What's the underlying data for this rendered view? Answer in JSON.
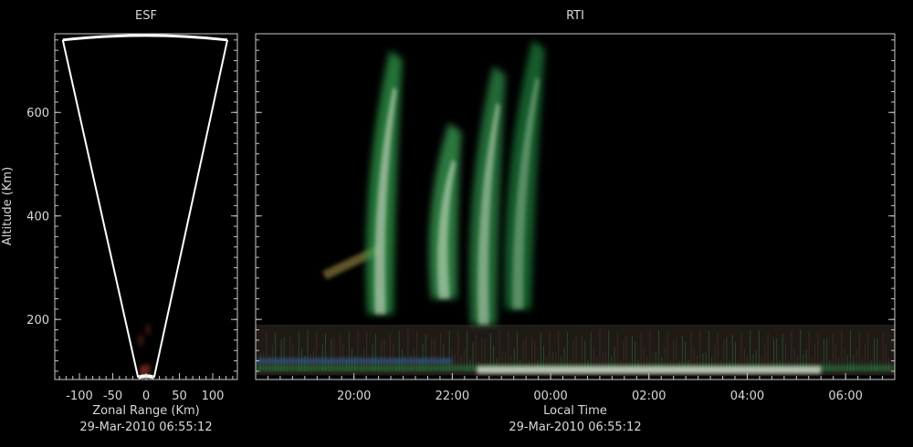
{
  "colors": {
    "background": "#000000",
    "axes": "#c8c8c8",
    "text": "#d8d8d8",
    "fan_outline": "#ffffff",
    "echo_green": "#2f9a4a",
    "echo_white": "#e8e8e0",
    "echo_olive": "#8a7a3a",
    "echo_blue": "#3a6fb8",
    "echo_red": "#a03a2a"
  },
  "chart_data": [
    {
      "type": "heatmap",
      "title": "ESF",
      "xlabel": "Zonal Range (Km)",
      "ylabel": "Altitude (Km)",
      "timestamp": "29-Mar-2010 06:55:12",
      "xlim": [
        -137,
        137
      ],
      "ylim": [
        84,
        752
      ],
      "xticks": [
        -100,
        -50,
        0,
        50,
        100
      ],
      "xtick_labels": [
        "-100",
        "-50",
        "0",
        "50",
        "100"
      ],
      "yticks": [
        200,
        400,
        600
      ],
      "ytick_labels": [
        "200",
        "400",
        "600"
      ],
      "beam_fan": {
        "left_edge": [
          [
            -12,
            88
          ],
          [
            -125,
            740
          ]
        ],
        "right_edge": [
          [
            12,
            88
          ],
          [
            122,
            740
          ]
        ],
        "top_arc_altitude": 745,
        "bottom_arc_altitude": 88
      },
      "echoes": [
        {
          "x": -5,
          "alt": 100,
          "intensity": 0.6
        },
        {
          "x": 2,
          "alt": 103,
          "intensity": 0.5
        },
        {
          "x": -8,
          "alt": 160,
          "intensity": 0.3
        },
        {
          "x": 3,
          "alt": 180,
          "intensity": 0.25
        }
      ]
    },
    {
      "type": "heatmap",
      "title": "RTI",
      "xlabel": "Local Time",
      "ylabel": "Altitude (Km)",
      "timestamp": "29-Mar-2010 06:55:12",
      "xlim": [
        18.0,
        31.0
      ],
      "ylim": [
        84,
        752
      ],
      "xticks": [
        20,
        22,
        24,
        26,
        28,
        30
      ],
      "xtick_labels": [
        "20:00",
        "22:00",
        "00:00",
        "02:00",
        "04:00",
        "06:00"
      ],
      "yticks": [
        200,
        400,
        600
      ],
      "plumes": [
        {
          "time_base": 20.5,
          "time_top": 20.8,
          "alt_base": 210,
          "alt_top": 720,
          "color": "#2f9a4a",
          "core": "#e6e6dc"
        },
        {
          "time_base": 21.8,
          "time_top": 22.0,
          "alt_base": 240,
          "alt_top": 580,
          "color": "#3aa055",
          "core": "#d8e8d0"
        },
        {
          "time_base": 22.6,
          "time_top": 22.9,
          "alt_base": 190,
          "alt_top": 690,
          "color": "#2e8c48",
          "core": "#c8dcc0"
        },
        {
          "time_base": 23.3,
          "time_top": 23.7,
          "alt_base": 220,
          "alt_top": 740,
          "color": "#1f7a3a",
          "core": "#8fb890"
        }
      ],
      "tilted_streak": {
        "t0": 19.4,
        "alt0": 285,
        "t1": 20.5,
        "alt1": 335,
        "color": "#8a7a3a"
      },
      "e_region_band": {
        "t_start": 18.0,
        "t_end": 31.0,
        "alt_low": 92,
        "alt_high": 190
      },
      "bright_low_band": {
        "t_start": 22.5,
        "t_end": 29.5,
        "alt_low": 95,
        "alt_high": 110,
        "color": "#e8e8e0"
      }
    }
  ]
}
